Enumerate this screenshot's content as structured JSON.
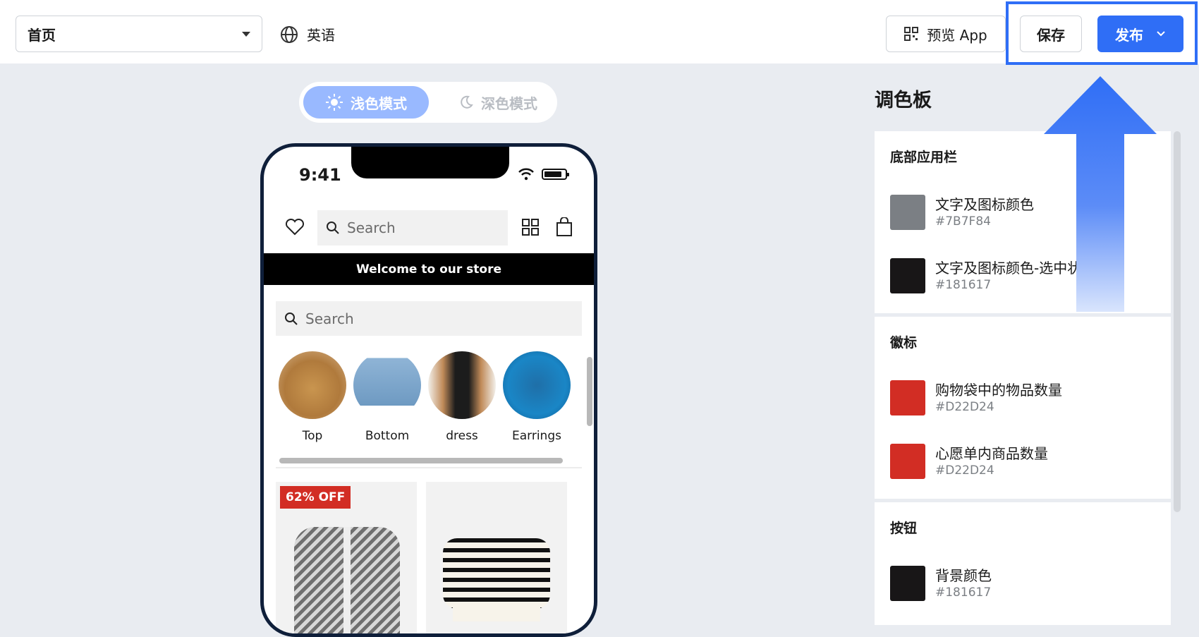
{
  "topbar": {
    "page_select": "首页",
    "language": "英语",
    "preview_label": "预览 App",
    "save_label": "保存",
    "publish_label": "发布"
  },
  "mode": {
    "light": "浅色模式",
    "dark": "深色模式",
    "selected": "light"
  },
  "phone": {
    "time": "9:41",
    "header_search_placeholder": "Search",
    "banner": "Welcome to our store",
    "body_search_placeholder": "Search",
    "categories": [
      {
        "name": "Top"
      },
      {
        "name": "Bottom"
      },
      {
        "name": "dress"
      },
      {
        "name": "Earrings"
      }
    ],
    "products": [
      {
        "badge": "62% OFF"
      },
      {
        "badge": ""
      }
    ]
  },
  "palette": {
    "title": "调色板",
    "sections": [
      {
        "title": "底部应用栏",
        "items": [
          {
            "name": "文字及图标颜色",
            "hex": "#7B7F84",
            "color": "#7B7F84"
          },
          {
            "name": "文字及图标颜色-选中状",
            "hex": "#181617",
            "color": "#181617"
          }
        ]
      },
      {
        "title": "徽标",
        "items": [
          {
            "name": "购物袋中的物品数量",
            "hex": "#D22D24",
            "color": "#D22D24"
          },
          {
            "name": "心愿单内商品数量",
            "hex": "#D22D24",
            "color": "#D22D24"
          }
        ]
      },
      {
        "title": "按钮",
        "items": [
          {
            "name": "背景颜色",
            "hex": "#181617",
            "color": "#181617"
          }
        ]
      }
    ]
  },
  "colors": {
    "accent": "#2f6ef6",
    "badge": "#d22d24",
    "light_mode_pill": "#99b9ff"
  },
  "icons": [
    "globe-icon",
    "qr-icon",
    "chevron-down-icon",
    "sun-icon",
    "moon-icon",
    "heart-icon",
    "search-icon",
    "grid-icon",
    "shopping-bag-icon",
    "wifi-icon",
    "battery-icon"
  ]
}
